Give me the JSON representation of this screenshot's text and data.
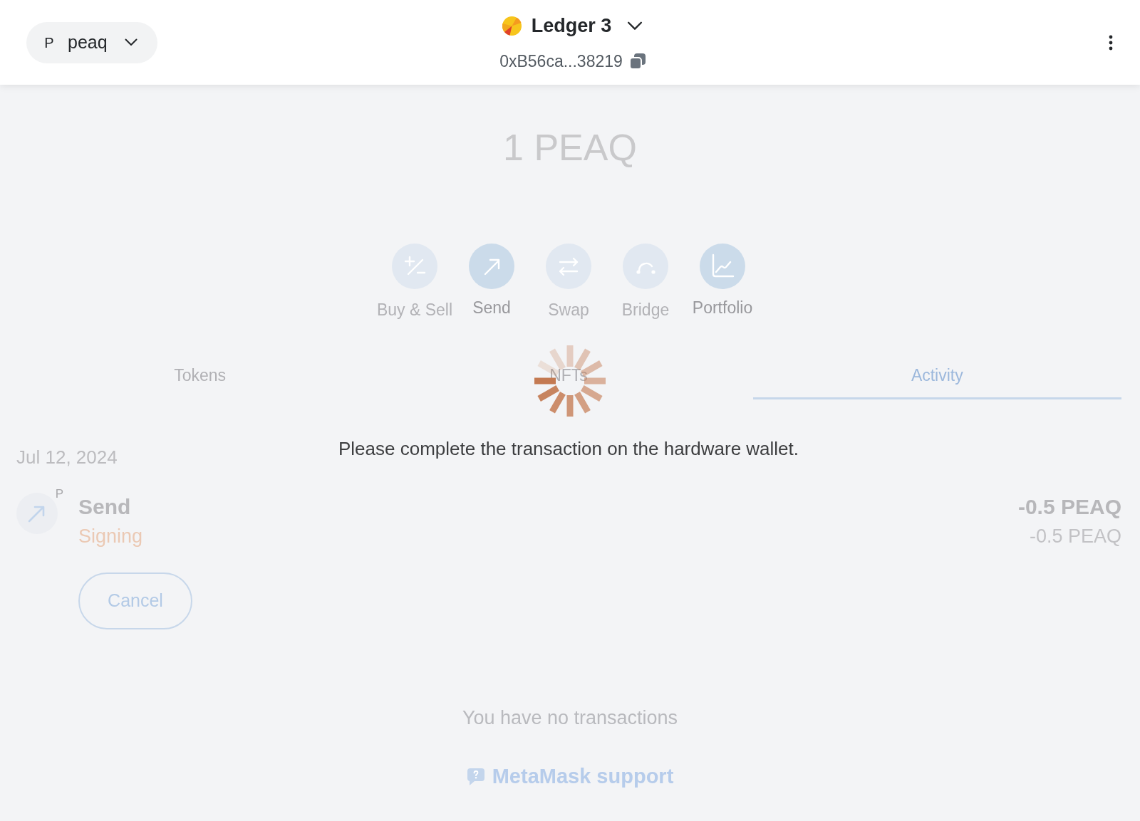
{
  "header": {
    "network": {
      "initial": "P",
      "name": "peaq"
    },
    "account": {
      "name": "Ledger 3",
      "address": "0xB56ca...38219"
    }
  },
  "balance": "1 PEAQ",
  "actions": [
    {
      "label": "Buy & Sell",
      "kind": "buy-sell",
      "disabled": true
    },
    {
      "label": "Send",
      "kind": "send",
      "disabled": false
    },
    {
      "label": "Swap",
      "kind": "swap",
      "disabled": true
    },
    {
      "label": "Bridge",
      "kind": "bridge",
      "disabled": true
    },
    {
      "label": "Portfolio",
      "kind": "portfolio",
      "disabled": false
    }
  ],
  "tabs": [
    {
      "label": "Tokens",
      "selected": false
    },
    {
      "label": "NFTs",
      "selected": false
    },
    {
      "label": "Activity",
      "selected": true
    }
  ],
  "activity": {
    "groups": [
      {
        "date": "Jul 12, 2024",
        "transactions": [
          {
            "title": "Send",
            "token_badge": "P",
            "status": "Signing",
            "amount": "-0.5 PEAQ",
            "secondary_amount": "-0.5 PEAQ",
            "action": "Cancel"
          }
        ]
      }
    ],
    "empty_message": "You have no transactions",
    "support_link": "MetaMask support"
  },
  "overlay": {
    "message": "Please complete the transaction on the hardware wallet."
  }
}
